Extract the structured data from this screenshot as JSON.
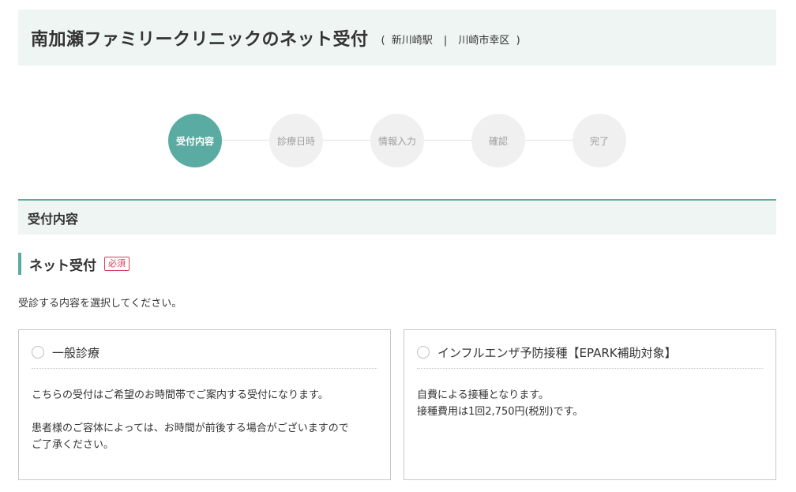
{
  "header": {
    "clinic_name": "南加瀬ファミリークリニックのネット受付",
    "open_paren": "(",
    "station": "新川崎駅",
    "separator": "|",
    "area": "川崎市幸区",
    "close_paren": ")"
  },
  "steps": [
    {
      "label": "受付内容",
      "active": true
    },
    {
      "label": "診療日時",
      "active": false
    },
    {
      "label": "情報入力",
      "active": false
    },
    {
      "label": "確認",
      "active": false
    },
    {
      "label": "完了",
      "active": false
    }
  ],
  "section": {
    "title": "受付内容"
  },
  "subsection": {
    "title": "ネット受付",
    "required_badge": "必須"
  },
  "instruction": "受診する内容を選択してください。",
  "options": [
    {
      "title": "一般診療",
      "lines": [
        "こちらの受付はご希望のお時間帯でご案内する受付になります。",
        "",
        "患者様のご容体によっては、お時間が前後する場合がございますので",
        "ご了承ください。"
      ]
    },
    {
      "title": "インフルエンザ予防接種【EPARK補助対象】",
      "lines": [
        "自費による接種となります。",
        "接種費用は1回2,750円(税別)です。"
      ]
    }
  ],
  "colors": {
    "accent": "#5aaba1",
    "header_bg": "#eef5f3",
    "required": "#d0425a"
  }
}
